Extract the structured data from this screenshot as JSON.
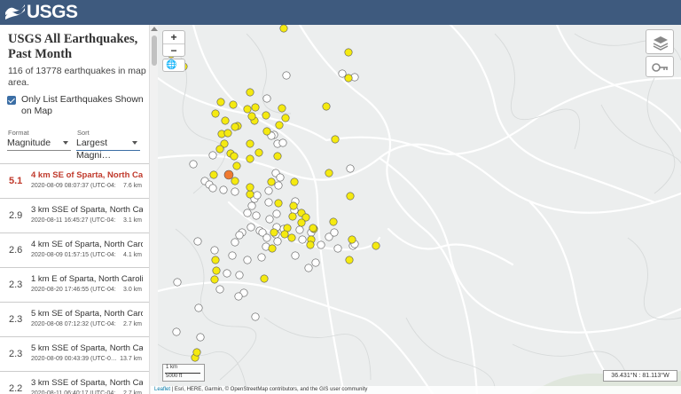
{
  "header": {
    "logo_text": "USGS"
  },
  "sidebar": {
    "title": "USGS All Earthquakes, Past Month",
    "count_text": "116 of 13778 earthquakes in map area.",
    "only_list_label": "Only List Earthquakes Shown on Map",
    "format": {
      "label": "Format",
      "value": "Magnitude"
    },
    "sort": {
      "label": "Sort",
      "value": "Largest Magni…"
    }
  },
  "earthquakes": [
    {
      "mag": "5.1",
      "place": "4 km SE of Sparta, North Caro…",
      "time": "2020-08-09 08:07:37 (UTC-04:…",
      "depth": "7.6 km"
    },
    {
      "mag": "2.9",
      "place": "3 km SSE of Sparta, North Car…",
      "time": "2020-08-11 16:45:27 (UTC-04:…",
      "depth": "3.1 km"
    },
    {
      "mag": "2.6",
      "place": "4 km SE of Sparta, North Caro…",
      "time": "2020-08-09 01:57:15 (UTC-04:…",
      "depth": "4.1 km"
    },
    {
      "mag": "2.3",
      "place": "1 km E of Sparta, North Caroli…",
      "time": "2020-08-20 17:46:55 (UTC-04:…",
      "depth": "3.0 km"
    },
    {
      "mag": "2.3",
      "place": "5 km SE of Sparta, North Caro…",
      "time": "2020-08-08 07:12:32 (UTC-04:…",
      "depth": "2.7 km"
    },
    {
      "mag": "2.3",
      "place": "5 km SSE of Sparta, North Car…",
      "time": "2020-08-09 00:43:39 (UTC-0…",
      "depth": "13.7 km"
    },
    {
      "mag": "2.2",
      "place": "3 km SSE of Sparta, North Car…",
      "time": "2020-08-11 06:40:17 (UTC-04:…",
      "depth": "2.7 km"
    }
  ],
  "map": {
    "zoom_in": "+",
    "zoom_out": "−",
    "scale_metric": "1 km",
    "scale_imperial": "5000 ft",
    "coordinates": "36.431°N : 81.113°W",
    "attribution_leaflet": "Leaflet",
    "attribution_rest": " | Esri, HERE, Garmin, © OpenStreetMap contributors, and the GIS user community",
    "colors": {
      "yellow": "#f5ea10",
      "white": "#ffffff",
      "highlight": "#f07a30",
      "marker_stroke": "#555555"
    }
  }
}
